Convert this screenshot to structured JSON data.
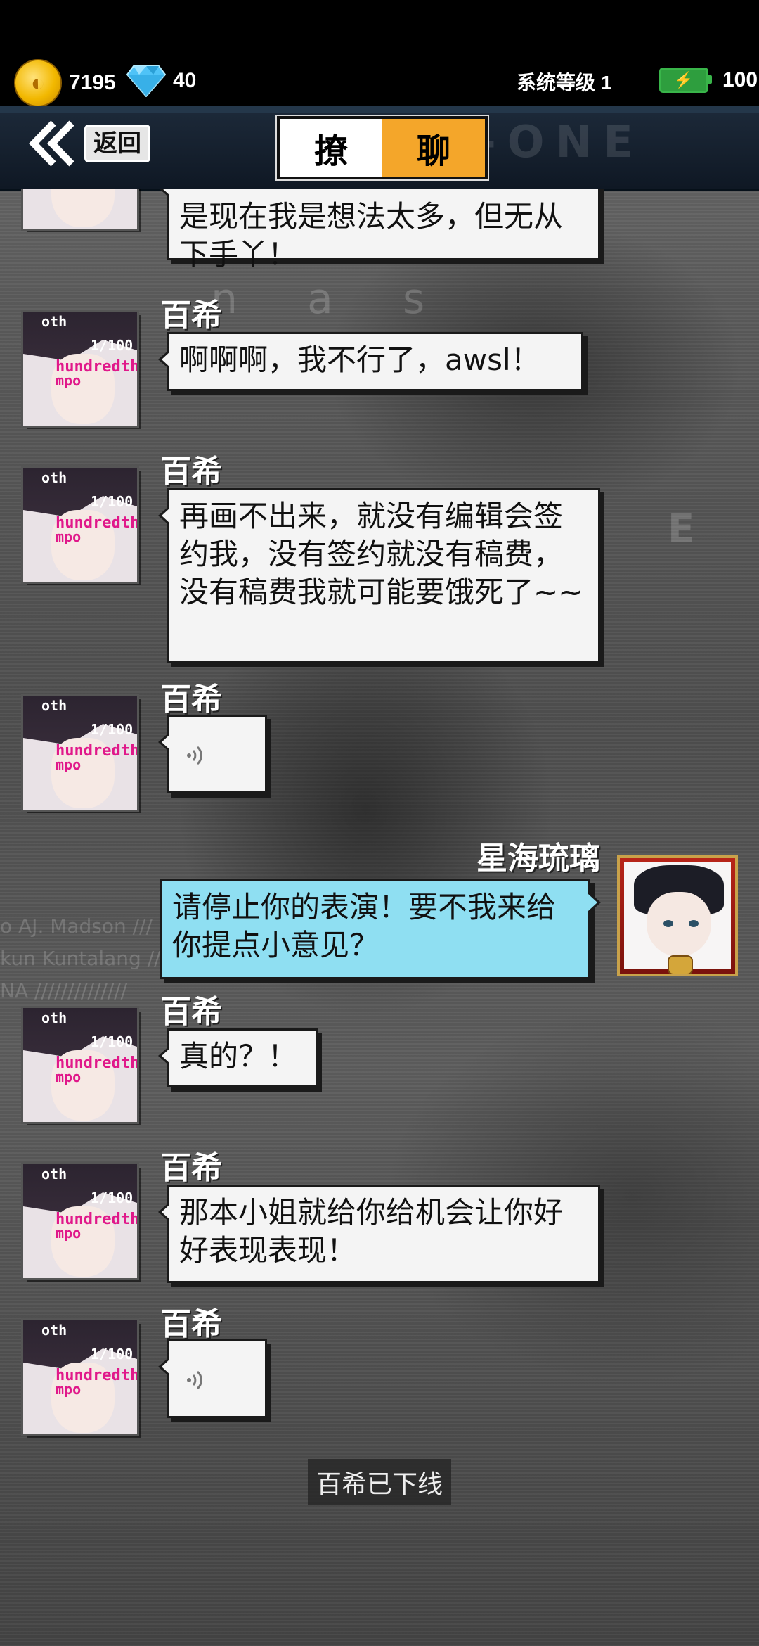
{
  "status": {
    "coins": "7195",
    "gems": "40",
    "system_level": "系统等级 1",
    "energy": "100"
  },
  "header": {
    "back_label": "返回",
    "title_left": "撩",
    "title_right": "聊",
    "watermark": "-ONE"
  },
  "partner": {
    "name": "百希",
    "avatar_text": [
      "oth",
      "1/100",
      "hundredth",
      "mpo"
    ]
  },
  "me": {
    "name": "星海琉璃"
  },
  "messages": [
    {
      "sender": "partner",
      "type": "text",
      "text": "是现在我是想法太多，但无从下手丫！"
    },
    {
      "sender": "partner",
      "type": "text",
      "text": "啊啊啊，我不行了，awsl！"
    },
    {
      "sender": "partner",
      "type": "text",
      "text": "再画不出来，就没有编辑会签约我，没有签约就没有稿费，没有稿费我就可能要饿死了~~"
    },
    {
      "sender": "partner",
      "type": "voice",
      "text": ""
    },
    {
      "sender": "me",
      "type": "text",
      "text": "请停止你的表演！要不我来给你提点小意见？"
    },
    {
      "sender": "partner",
      "type": "text",
      "text": "真的？！"
    },
    {
      "sender": "partner",
      "type": "text",
      "text": "那本小姐就给你给机会让你好好表现表现！"
    },
    {
      "sender": "partner",
      "type": "voice",
      "text": ""
    }
  ],
  "system_message": "百希已下线",
  "colors": {
    "accent_orange": "#f4a62a",
    "my_bubble": "#8fdff2",
    "partner_bubble": "#f4f4f4",
    "header_bg": "#1d2a3a"
  }
}
